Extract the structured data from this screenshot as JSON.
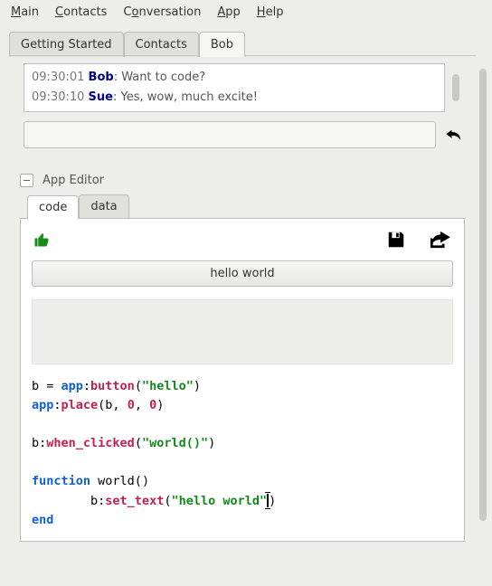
{
  "menubar": {
    "main": {
      "u": "M",
      "rest": "ain"
    },
    "contacts": {
      "u": "C",
      "rest": "ontacts"
    },
    "conversation": {
      "pre": "C",
      "u": "o",
      "rest": "nversation"
    },
    "app": {
      "u": "A",
      "rest": "pp"
    },
    "help": {
      "u": "H",
      "rest": "elp"
    }
  },
  "main_tabs": {
    "getting_started": "Getting Started",
    "contacts": "Contacts",
    "bob": "Bob"
  },
  "chat": {
    "line1": {
      "ts": "09:30:01",
      "nick": "Bob",
      "msg": "Want to code?"
    },
    "line2": {
      "ts": "09:30:10",
      "nick": "Sue",
      "msg": "Yes, wow, much excite!"
    }
  },
  "editor": {
    "section_title": "App Editor",
    "collapse_glyph": "−",
    "tabs": {
      "code": "code",
      "data": "data"
    },
    "run_button": "hello world",
    "code": {
      "l1_id": "b = ",
      "l1_kw": "app",
      "l1_sep": ":",
      "l1_fn": "button",
      "l1_p1": "(",
      "l1_str": "\"hello\"",
      "l1_p2": ")",
      "l2_kw": "app",
      "l2_sep": ":",
      "l2_fn": "place",
      "l2_p1": "(b, ",
      "l2_n1": "0",
      "l2_c": ", ",
      "l2_n2": "0",
      "l2_p2": ")",
      "l4_id": "b:",
      "l4_fn": "when_clicked",
      "l4_p1": "(",
      "l4_str": "\"world()\"",
      "l4_p2": ")",
      "l6_kw": "function",
      "l6_sp": " ",
      "l6_name": "world()",
      "l7_indent": "        ",
      "l7_id": "b:",
      "l7_fn": "set_text",
      "l7_p1": "(",
      "l7_str": "\"hello world\"",
      "l7_p2": ")",
      "l8_kw": "end"
    }
  }
}
